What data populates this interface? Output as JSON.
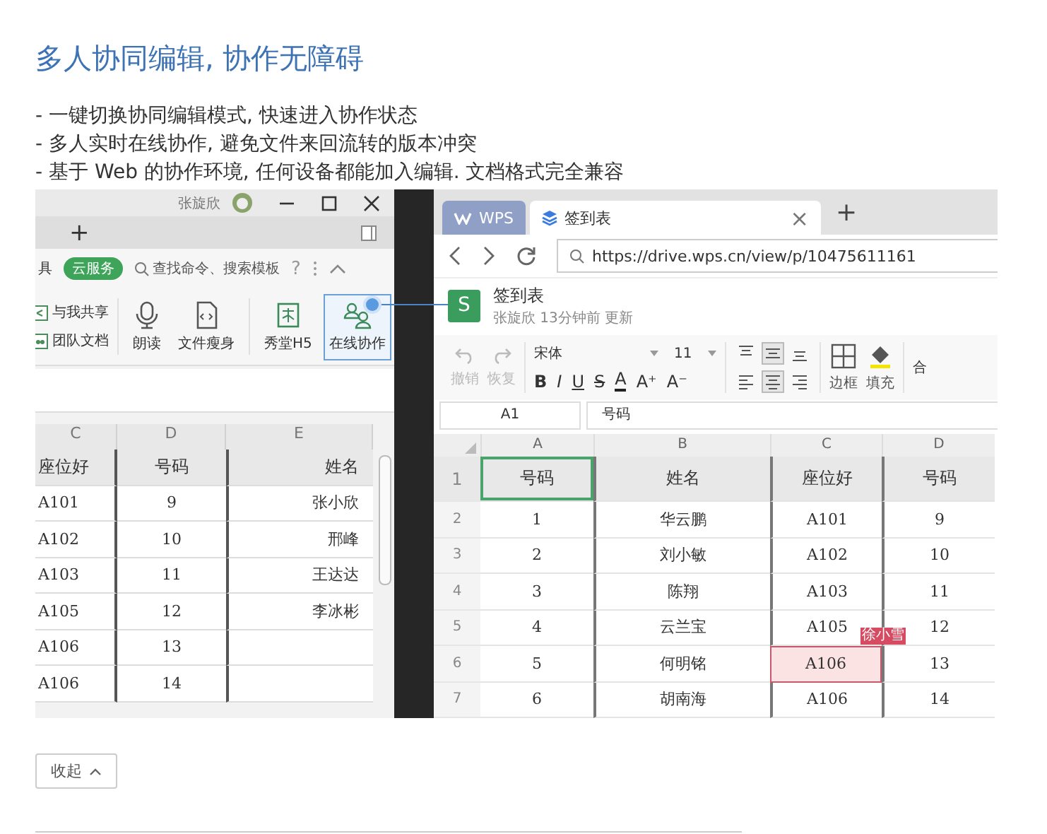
{
  "heading": "多人协同编辑, 协作无障碍",
  "bullets": [
    "- 一键切换协同编辑模式, 快速进入协作状态",
    "- 多人实时在线协作, 避免文件来回流转的版本冲突",
    "- 基于 Web 的协作环境, 任何设备都能加入编辑. 文档格式完全兼容"
  ],
  "desktop_app": {
    "user_name": "张旋欣",
    "new_tab": "+",
    "cut_label": "具",
    "cloud_button": "云服务",
    "search_placeholder": "查找命令、搜索模板",
    "help": "?",
    "share_items": [
      {
        "label": "与我共享",
        "kind": "share"
      },
      {
        "label": "团队文档",
        "kind": "team"
      }
    ],
    "ribbon_buttons": [
      {
        "label": "朗读",
        "kind": "mic",
        "selected": false
      },
      {
        "label": "文件瘦身",
        "kind": "file",
        "selected": false
      },
      {
        "label": "秀堂H5",
        "kind": "show",
        "selected": false
      },
      {
        "label": "在线协作",
        "kind": "collab",
        "selected": true
      }
    ],
    "column_letters": [
      "C",
      "D",
      "E"
    ],
    "rows": [
      [
        "座位好",
        "号码",
        "姓名"
      ],
      [
        "A101",
        "9",
        "张小欣"
      ],
      [
        "A102",
        "10",
        "邢峰"
      ],
      [
        "A103",
        "11",
        "王达达"
      ],
      [
        "A105",
        "12",
        "李冰彬"
      ],
      [
        "A106",
        "13",
        ""
      ],
      [
        "A106",
        "14",
        ""
      ]
    ]
  },
  "browser": {
    "tabs": [
      {
        "label": "WPS",
        "kind": "home",
        "selected": false
      },
      {
        "label": "签到表",
        "kind": "doc",
        "selected": true
      }
    ],
    "close_tab": "×",
    "new_tab": "+",
    "url": "https://drive.wps.cn/view/p/10475611161",
    "doc_icon_letter": "S",
    "doc_title": "签到表",
    "doc_meta": "张旋欣 13分钟前 更新",
    "toolbar": {
      "undo": "撤销",
      "redo": "恢复",
      "font": "宋体",
      "size": "11",
      "format_buttons": [
        {
          "label": "B",
          "kind": "bold"
        },
        {
          "label": "I",
          "kind": "italic"
        },
        {
          "label": "U",
          "kind": "underline"
        },
        {
          "label": "S",
          "kind": "strike"
        },
        {
          "label": "A",
          "kind": "color"
        }
      ],
      "grow": "A⁺",
      "shrink": "A⁻",
      "align_buttons": [
        {
          "kind": "top",
          "selected": false
        },
        {
          "kind": "middle",
          "selected": true
        },
        {
          "kind": "bottom",
          "selected": false
        },
        {
          "kind": "left",
          "selected": false
        },
        {
          "kind": "center",
          "selected": true
        },
        {
          "kind": "right",
          "selected": false
        }
      ],
      "border": "边框",
      "fill": "填充",
      "cut_label": "合"
    },
    "cell_ref": "A1",
    "formula": "号码",
    "columns": [
      "A",
      "B",
      "C",
      "D"
    ],
    "collaborator": "徐小雪",
    "rows": [
      {
        "number": "1",
        "cells": [
          {
            "text": "号码",
            "selected": true,
            "marked": false
          },
          {
            "text": "姓名",
            "selected": false,
            "marked": false
          },
          {
            "text": "座位好",
            "selected": false,
            "marked": false
          },
          {
            "text": "号码",
            "selected": false,
            "marked": false
          }
        ]
      },
      {
        "number": "2",
        "cells": [
          {
            "text": "1",
            "selected": false,
            "marked": false
          },
          {
            "text": "华云鹏",
            "selected": false,
            "marked": false
          },
          {
            "text": "A101",
            "selected": false,
            "marked": false
          },
          {
            "text": "9",
            "selected": false,
            "marked": false
          }
        ]
      },
      {
        "number": "3",
        "cells": [
          {
            "text": "2",
            "selected": false,
            "marked": false
          },
          {
            "text": "刘小敏",
            "selected": false,
            "marked": false
          },
          {
            "text": "A102",
            "selected": false,
            "marked": false
          },
          {
            "text": "10",
            "selected": false,
            "marked": false
          }
        ]
      },
      {
        "number": "4",
        "cells": [
          {
            "text": "3",
            "selected": false,
            "marked": false
          },
          {
            "text": "陈翔",
            "selected": false,
            "marked": false
          },
          {
            "text": "A103",
            "selected": false,
            "marked": false
          },
          {
            "text": "11",
            "selected": false,
            "marked": false
          }
        ]
      },
      {
        "number": "5",
        "cells": [
          {
            "text": "4",
            "selected": false,
            "marked": false
          },
          {
            "text": "云兰宝",
            "selected": false,
            "marked": false
          },
          {
            "text": "A105",
            "selected": false,
            "marked": false
          },
          {
            "text": "12",
            "selected": false,
            "marked": false
          }
        ]
      },
      {
        "number": "6",
        "cells": [
          {
            "text": "5",
            "selected": false,
            "marked": false
          },
          {
            "text": "何明铭",
            "selected": false,
            "marked": false
          },
          {
            "text": "A106",
            "selected": false,
            "marked": true
          },
          {
            "text": "13",
            "selected": false,
            "marked": false
          }
        ]
      },
      {
        "number": "7",
        "cells": [
          {
            "text": "6",
            "selected": false,
            "marked": false
          },
          {
            "text": "胡南海",
            "selected": false,
            "marked": false
          },
          {
            "text": "A106",
            "selected": false,
            "marked": false
          },
          {
            "text": "14",
            "selected": false,
            "marked": false
          }
        ]
      }
    ]
  },
  "collapse_button": "收起"
}
